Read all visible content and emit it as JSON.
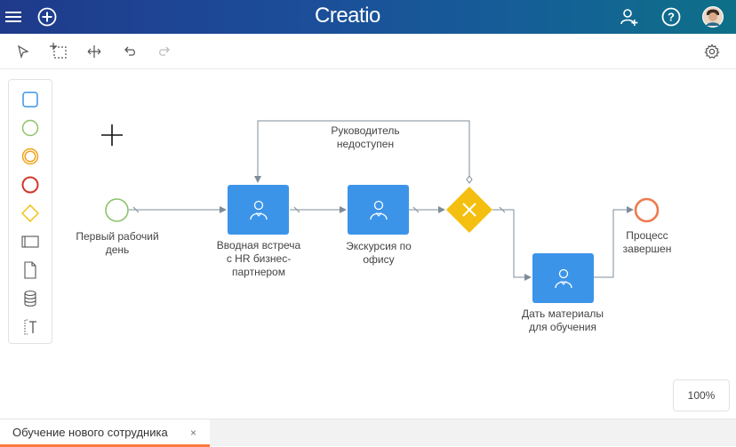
{
  "header": {
    "logo_text": "Creatio",
    "menu_icon": "hamburger-menu-icon",
    "add_icon": "plus-circle-icon",
    "add_user_icon": "add-user-icon",
    "help_icon": "help-circle-icon",
    "avatar_icon": "user-avatar",
    "colors": {
      "gradient_start": "#1f3a8a",
      "gradient_end": "#0e7088"
    }
  },
  "toolbar": {
    "tools": [
      "select-pointer-icon",
      "lasso-select-icon",
      "space-tool-icon",
      "undo-icon",
      "redo-icon"
    ],
    "settings_icon": "gear-icon"
  },
  "palette": {
    "items": [
      "task-shape-icon",
      "start-event-icon",
      "intermediate-event-icon",
      "end-event-icon",
      "gateway-icon",
      "pool-icon",
      "data-object-icon",
      "data-store-icon",
      "text-annotation-icon"
    ]
  },
  "diagram": {
    "start_label": "Первый рабочий\nдень",
    "task1_label": "Вводная встреча\nс HR бизнес-\nпартнером",
    "task2_label": "Экскурсия по\nофису",
    "task3_label": "Дать материалы\nдля обучения",
    "loop_label": "Руководитель\nнедоступен",
    "end_label": "Процесс\nзавершен",
    "colors": {
      "task": "#3c94e9",
      "start": "#8cc36a",
      "end": "#ee7a4e",
      "gateway": "#f4bf10",
      "flow": "#7f8c9a"
    }
  },
  "zoom": {
    "value": "100%"
  },
  "tabs": [
    {
      "label": "Обучение нового сотрудника",
      "close": "×"
    }
  ]
}
